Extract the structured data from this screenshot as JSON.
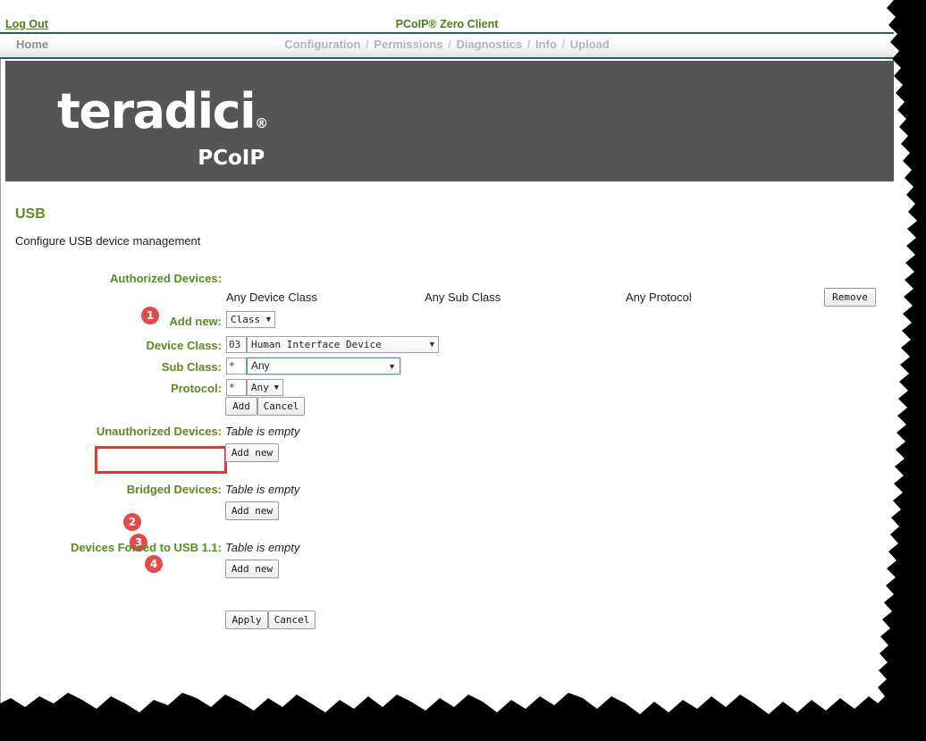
{
  "topbar": {
    "logout_label": "Log Out",
    "product_title": "PCoIP® Zero Client"
  },
  "nav": {
    "home_label": "Home",
    "items": [
      {
        "label": "Configuration"
      },
      {
        "label": "Permissions"
      },
      {
        "label": "Diagnostics"
      },
      {
        "label": "Info"
      },
      {
        "label": "Upload"
      }
    ],
    "separator": "/"
  },
  "banner": {
    "logo_text": "teradici",
    "logo_registered": "®",
    "logo_subtext": "PCoIP"
  },
  "page": {
    "title": "USB",
    "description": "Configure USB device management"
  },
  "colors": {
    "heading_green": "#5d8a1c",
    "badge_red": "#e24b47",
    "highlight_red": "#e8362c",
    "banner_gray": "#555555",
    "nav_border_teal": "#2f5d62",
    "focus_blue": "#4a90d9"
  },
  "authorized": {
    "label": "Authorized Devices:",
    "column_headers": [
      "Any Device Class",
      "Any Sub Class",
      "Any Protocol"
    ],
    "remove_label": "Remove",
    "fields": [
      {
        "badge": "1",
        "label": "Add new:",
        "kind": "select",
        "value": "Class",
        "focused": false
      },
      {
        "badge": "2",
        "label": "Device Class:",
        "kind": "code-select",
        "code": "03",
        "value": "Human Interface Device",
        "focused": false
      },
      {
        "badge": "3",
        "label": "Sub Class:",
        "kind": "code-select",
        "code": "*",
        "value": "Any",
        "focused": true
      },
      {
        "badge": "4",
        "label": "Protocol:",
        "kind": "code-select",
        "code": "*",
        "value": "Any",
        "focused": false
      }
    ],
    "add_label": "Add",
    "cancel_label": "Cancel"
  },
  "sections": [
    {
      "label": "Unauthorized Devices:",
      "status": "Table is empty",
      "add_new_label": "Add  new"
    },
    {
      "label": "Bridged Devices:",
      "status": "Table is empty",
      "add_new_label": "Add  new"
    },
    {
      "label": "Devices Forced to USB 1.1:",
      "status": "Table is empty",
      "add_new_label": "Add  new"
    }
  ],
  "footer": {
    "apply_label": "Apply",
    "cancel_label": "Cancel"
  }
}
